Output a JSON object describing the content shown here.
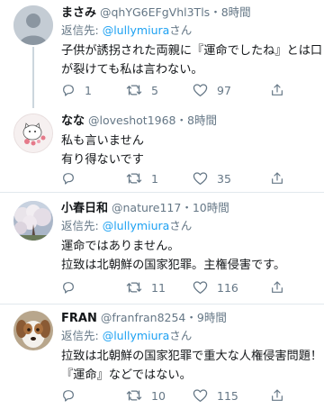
{
  "tweets": [
    {
      "name": "まさみ",
      "handle": "@qhYG6EFgVhl3Tls",
      "dot": "・",
      "time": "8時間",
      "reply_prefix": "返信先: ",
      "reply_to": "@lullymiura",
      "reply_suffix": "さん",
      "lines": [
        "子供が誘拐された両親に『運命でしたね』とは口",
        "が裂けても私は言わない。"
      ],
      "replies": "1",
      "retweets": "5",
      "likes": "97",
      "avatar": "default-avatar"
    },
    {
      "name": "なな",
      "handle": "@loveshot1968",
      "dot": "・",
      "time": "8時間",
      "reply_prefix": "",
      "reply_to": "",
      "reply_suffix": "",
      "lines": [
        "私も言いません",
        "有り得ないです"
      ],
      "replies": "",
      "retweets": "1",
      "likes": "35",
      "avatar": "cat-illustration-avatar"
    },
    {
      "name": "小春日和",
      "handle": "@nature117",
      "dot": "・",
      "time": "10時間",
      "reply_prefix": "返信先: ",
      "reply_to": "@lullymiura",
      "reply_suffix": "さん",
      "lines": [
        "運命ではありません。",
        "拉致は北朝鮮の国家犯罪。主権侵害です。"
      ],
      "replies": "",
      "retweets": "11",
      "likes": "116",
      "avatar": "cherry-blossom-avatar"
    },
    {
      "name": "FRAN",
      "handle": "@franfran8254",
      "dot": "・",
      "time": "9時間",
      "reply_prefix": "返信先: ",
      "reply_to": "@lullymiura",
      "reply_suffix": "さん",
      "lines": [
        "拉致は北朝鮮の国家犯罪で重大な人権侵害問題！",
        "『運命』などではない。"
      ],
      "replies": "",
      "retweets": "10",
      "likes": "115",
      "avatar": "dog-avatar"
    }
  ],
  "colors": {
    "accent": "#1da1f2",
    "secondary_text": "#657786",
    "divider": "#e1e8ed",
    "thread_line": "#ccd6dd"
  },
  "icons": [
    "reply-icon",
    "retweet-icon",
    "like-icon",
    "share-icon"
  ]
}
